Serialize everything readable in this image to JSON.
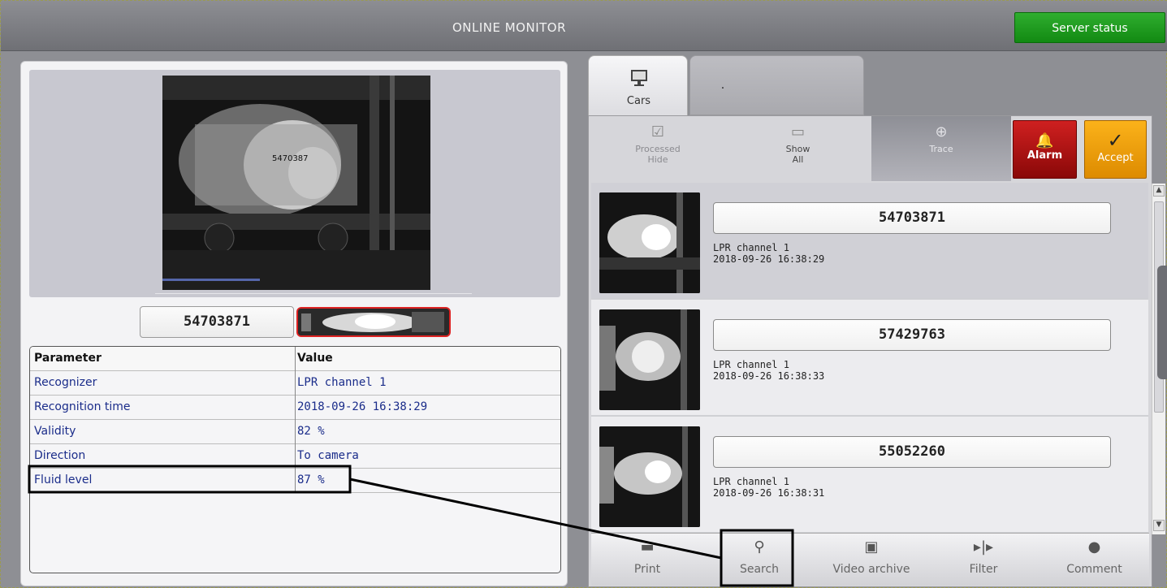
{
  "header": {
    "title": "ONLINE MONITOR",
    "server_status_label": "Server status"
  },
  "left": {
    "plate": "54703871",
    "table": {
      "headers": [
        "Parameter",
        "Value"
      ],
      "rows": [
        {
          "param": "Recognizer",
          "value": "LPR channel 1"
        },
        {
          "param": "Recognition time",
          "value": "2018-09-26 16:38:29"
        },
        {
          "param": "Validity",
          "value": "82 %"
        },
        {
          "param": "Direction",
          "value": "To camera"
        },
        {
          "param": "Fluid level",
          "value": "87 %"
        }
      ]
    }
  },
  "tabs": [
    {
      "label": "Cars",
      "icon": "monitor-icon"
    },
    {
      "label": "."
    }
  ],
  "toolbar": {
    "processed_hide": {
      "line1": "Processed",
      "line2": "Hide"
    },
    "show_all": {
      "line1": "Show",
      "line2": "All"
    },
    "trace": "Trace",
    "alarm": "Alarm",
    "accept": "Accept"
  },
  "cars": [
    {
      "plate": "54703871",
      "channel": "LPR channel 1",
      "time": "2018-09-26 16:38:29"
    },
    {
      "plate": "57429763",
      "channel": "LPR channel 1",
      "time": "2018-09-26 16:38:33"
    },
    {
      "plate": "55052260",
      "channel": "LPR channel 1",
      "time": "2018-09-26 16:38:31"
    }
  ],
  "bottom_bar": [
    {
      "label": "Print",
      "icon": "printer-icon"
    },
    {
      "label": "Search",
      "icon": "search-icon"
    },
    {
      "label": "Video archive",
      "icon": "film-icon"
    },
    {
      "label": "Filter",
      "icon": "filter-icon"
    },
    {
      "label": "Comment",
      "icon": "speech-bubble-icon"
    }
  ],
  "colors": {
    "server_status": "#1a9a1a",
    "alarm": "#b01010",
    "accept": "#f0a010",
    "row_text": "#1a2c8a"
  }
}
